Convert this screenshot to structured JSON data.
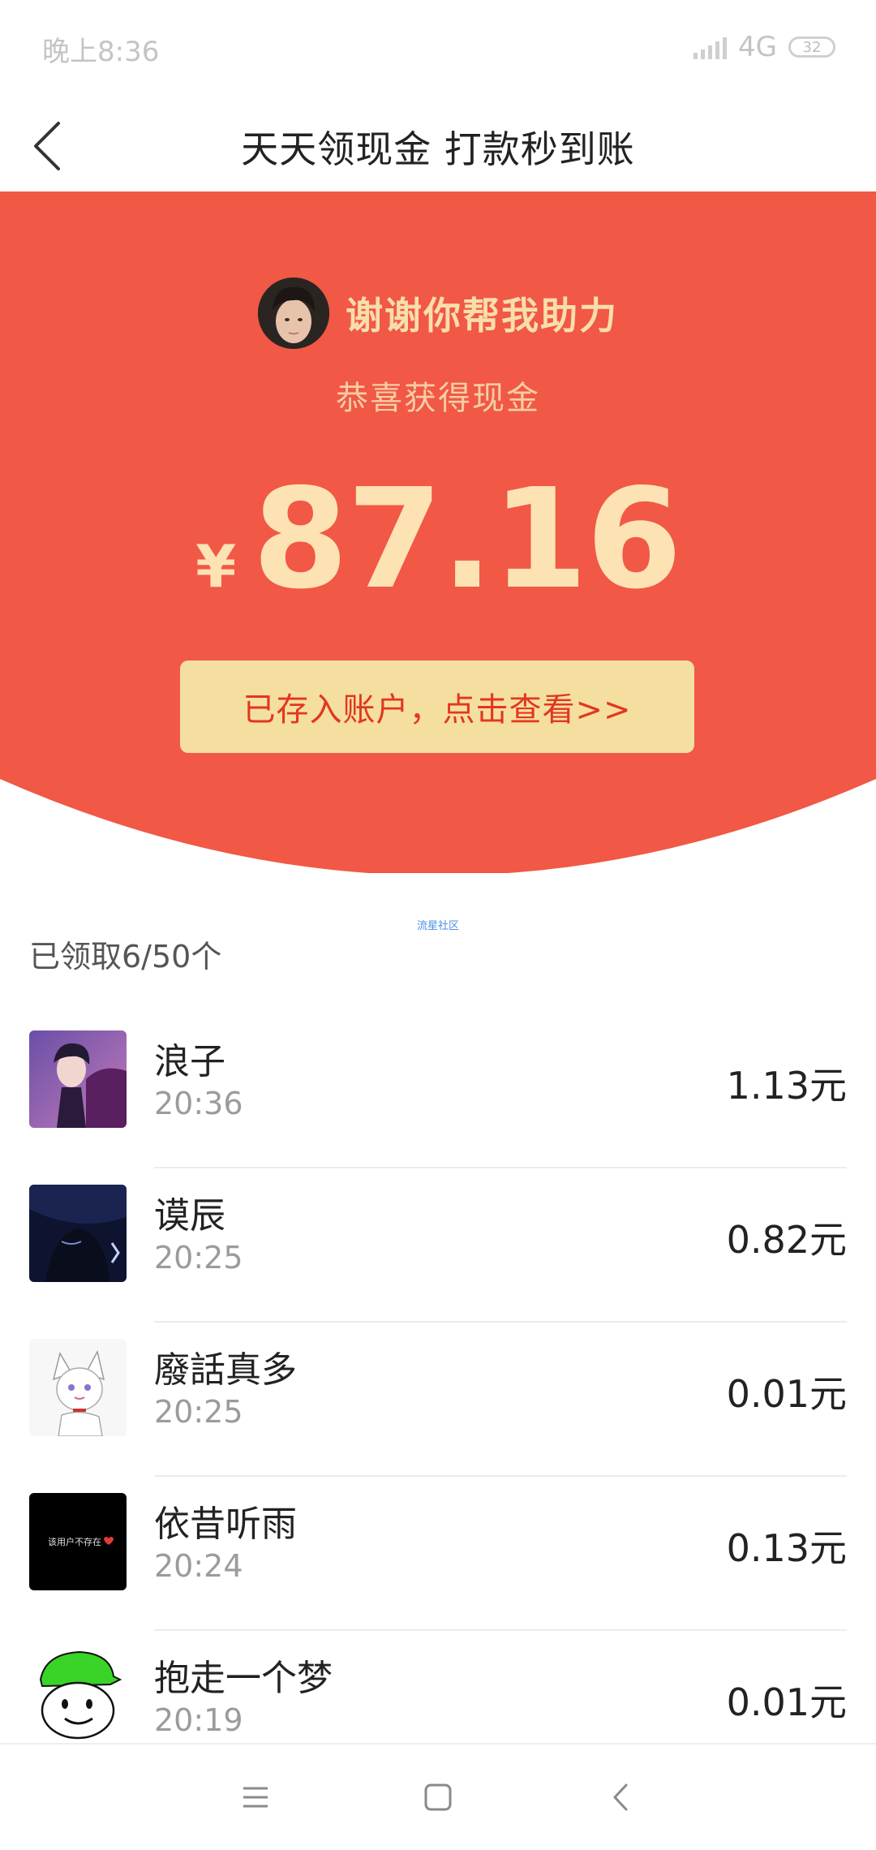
{
  "status_bar": {
    "time": "晚上8:36",
    "network": "4G",
    "battery": "32"
  },
  "nav": {
    "title": "天天领现金 打款秒到账"
  },
  "header": {
    "helper_text": "谢谢你帮我助力",
    "congrats": "恭喜获得现金",
    "currency_symbol": "¥",
    "amount": "87.16",
    "account_button": "已存入账户，点击查看>>",
    "background_color": "#f15845",
    "accent_color": "#fde2b3"
  },
  "watermark": "流星社区",
  "claimed_count": "已领取6/50个",
  "claims": [
    {
      "name": "浪子",
      "time": "20:36",
      "amount": "1.13元"
    },
    {
      "name": "谟辰",
      "time": "20:25",
      "amount": "0.82元"
    },
    {
      "name": "廢話真多",
      "time": "20:25",
      "amount": "0.01元"
    },
    {
      "name": "依昔听雨",
      "time": "20:24",
      "amount": "0.13元"
    },
    {
      "name": "抱走一个梦",
      "time": "20:19",
      "amount": "0.01元"
    }
  ],
  "thumb_text": {
    "dark_tile": "该用户不存在"
  }
}
